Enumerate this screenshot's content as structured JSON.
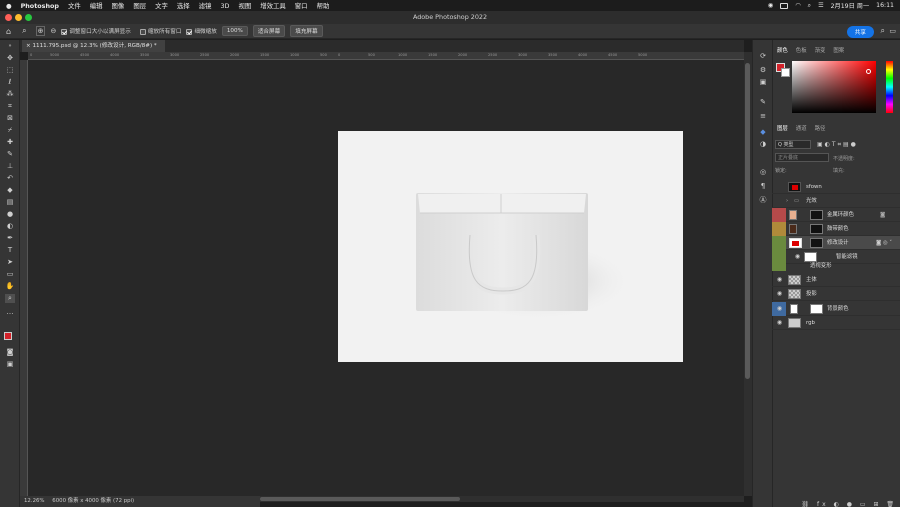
{
  "menubar": {
    "apple": "",
    "app_name": "Photoshop",
    "items": [
      "文件",
      "编辑",
      "图像",
      "图层",
      "文字",
      "选择",
      "滤镜",
      "3D",
      "视图",
      "增效工具",
      "窗口",
      "帮助"
    ],
    "date": "2月19日 周一",
    "time": "16:11"
  },
  "window": {
    "title": "Adobe Photoshop 2022"
  },
  "options": {
    "check1": "调整窗口大小以满屏显示",
    "check2": "缩放所有窗口",
    "check3": "细微缩放",
    "zoom_value": "100%",
    "fit_screen": "适合屏幕",
    "fill_screen": "填充屏幕",
    "share": "共享"
  },
  "document": {
    "tab_label": "1111.795.psd @ 12.3% (修改设计, RGB/8#) *"
  },
  "ruler": {
    "ticks": [
      "0",
      "5000",
      "4500",
      "4000",
      "3500",
      "3000",
      "2500",
      "2000",
      "1500",
      "1000",
      "500",
      "0",
      "500",
      "1000",
      "1500",
      "2000",
      "2500",
      "3000",
      "3500",
      "4000",
      "4500",
      "5000"
    ]
  },
  "status": {
    "zoom": "12.26%",
    "info": "6000 像素 x 4000 像素 (72 ppi)"
  },
  "colors_panel": {
    "tabs": [
      "颜色",
      "色板",
      "渐变",
      "图案"
    ],
    "fg": "#d3222a",
    "bg": "#ffffff"
  },
  "layers_panel": {
    "tabs": [
      "图层",
      "通道",
      "路径"
    ],
    "filter": "Q 类型",
    "blend": "正片叠底",
    "opacity_label": "不透明度:",
    "lock_label": "锁定:",
    "fill_label": "填充:",
    "layers": [
      {
        "name": "sfown",
        "color": "",
        "thumb": "red"
      },
      {
        "name": "光效",
        "color": "",
        "thumb": "folder"
      },
      {
        "name": "金属环颜色",
        "color": "#b54a4a",
        "thumb": "peach"
      },
      {
        "name": "鼓带颜色",
        "color": "#b08a3a",
        "thumb": "brown"
      },
      {
        "name": "修改设计",
        "color": "#6a8a3e",
        "thumb": "smart"
      },
      {
        "name": "智能滤镜",
        "color": "#6a8a3e",
        "thumb": "white"
      },
      {
        "name": "透视变形",
        "color": "#6a8a3e",
        "thumb": ""
      },
      {
        "name": "主体",
        "color": "",
        "thumb": "checker"
      },
      {
        "name": "投影",
        "color": "",
        "thumb": "checker"
      },
      {
        "name": "背景颜色",
        "color": "#3f6aa0",
        "thumb": "white2"
      },
      {
        "name": "rgb",
        "color": "",
        "thumb": "gray"
      }
    ]
  }
}
